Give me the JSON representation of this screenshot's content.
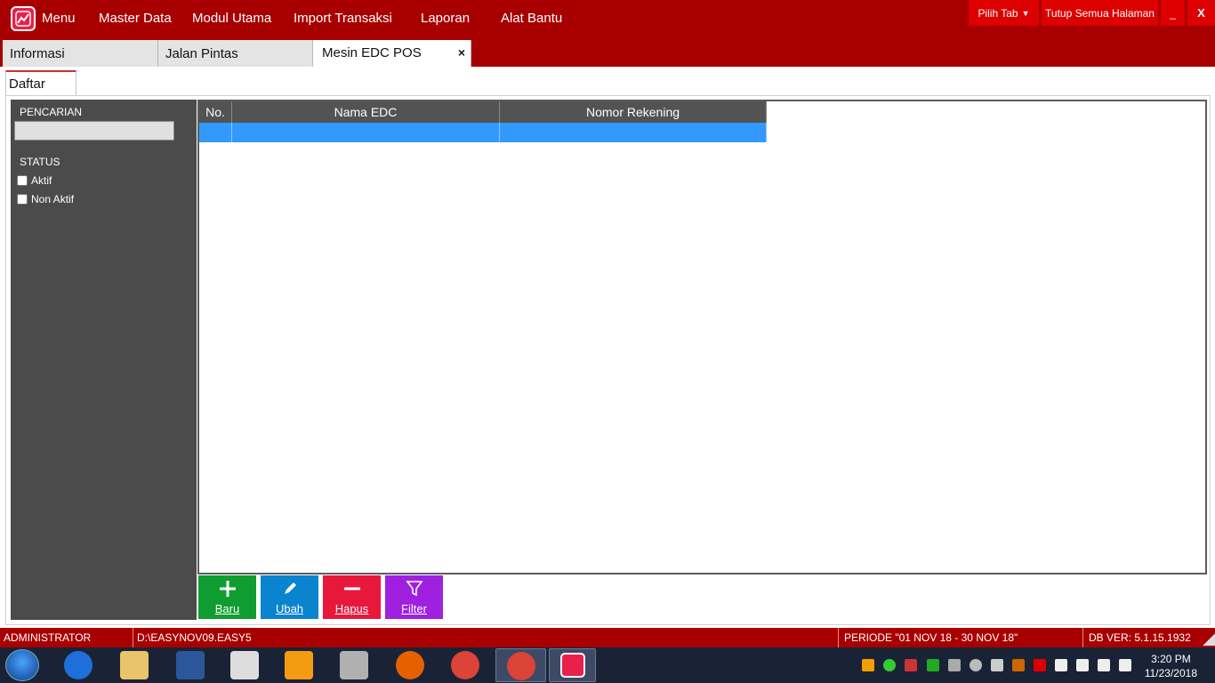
{
  "menu": {
    "items": [
      "Menu",
      "Master Data",
      "Modul Utama",
      "Import Transaksi",
      "Laporan",
      "Alat Bantu"
    ]
  },
  "window_controls": {
    "pilih_tab": "Pilih Tab",
    "tutup_semua": "Tutup Semua Halaman",
    "minimize": "_",
    "close": "X"
  },
  "tabs": [
    "Informasi",
    "Jalan Pintas",
    "Mesin EDC POS"
  ],
  "active_tab_close": "×",
  "subtab": "Daftar",
  "sidebar": {
    "search_label": "PENCARIAN",
    "search_value": "",
    "status_label": "STATUS",
    "status_options": [
      "Aktif",
      "Non Aktif"
    ]
  },
  "grid": {
    "columns": [
      "No.",
      "Nama EDC",
      "Nomor Rekening"
    ],
    "selected_row": [
      "",
      "",
      ""
    ]
  },
  "actions": [
    "Baru",
    "Ubah",
    "Hapus",
    "Filter"
  ],
  "statusbar": {
    "user": "ADMINISTRATOR",
    "db_path": "D:\\EASYNOV09.EASY5",
    "periode": "PERIODE \"01 NOV 18 - 30 NOV 18\"",
    "db_ver": "DB VER: 5.1.15.1932"
  },
  "taskbar": {
    "time": "3:20 PM",
    "date": "11/23/2018"
  },
  "colors": {
    "brand_red": "#a80000",
    "btn_red": "#dd0000",
    "sidebar_bg": "#4b4b4b",
    "grid_header": "#535353",
    "row_selected": "#3399ff",
    "btn_baru": "#0f9d32",
    "btn_ubah": "#0a84cf",
    "btn_hapus": "#e8183c",
    "btn_filter": "#a020e0"
  }
}
